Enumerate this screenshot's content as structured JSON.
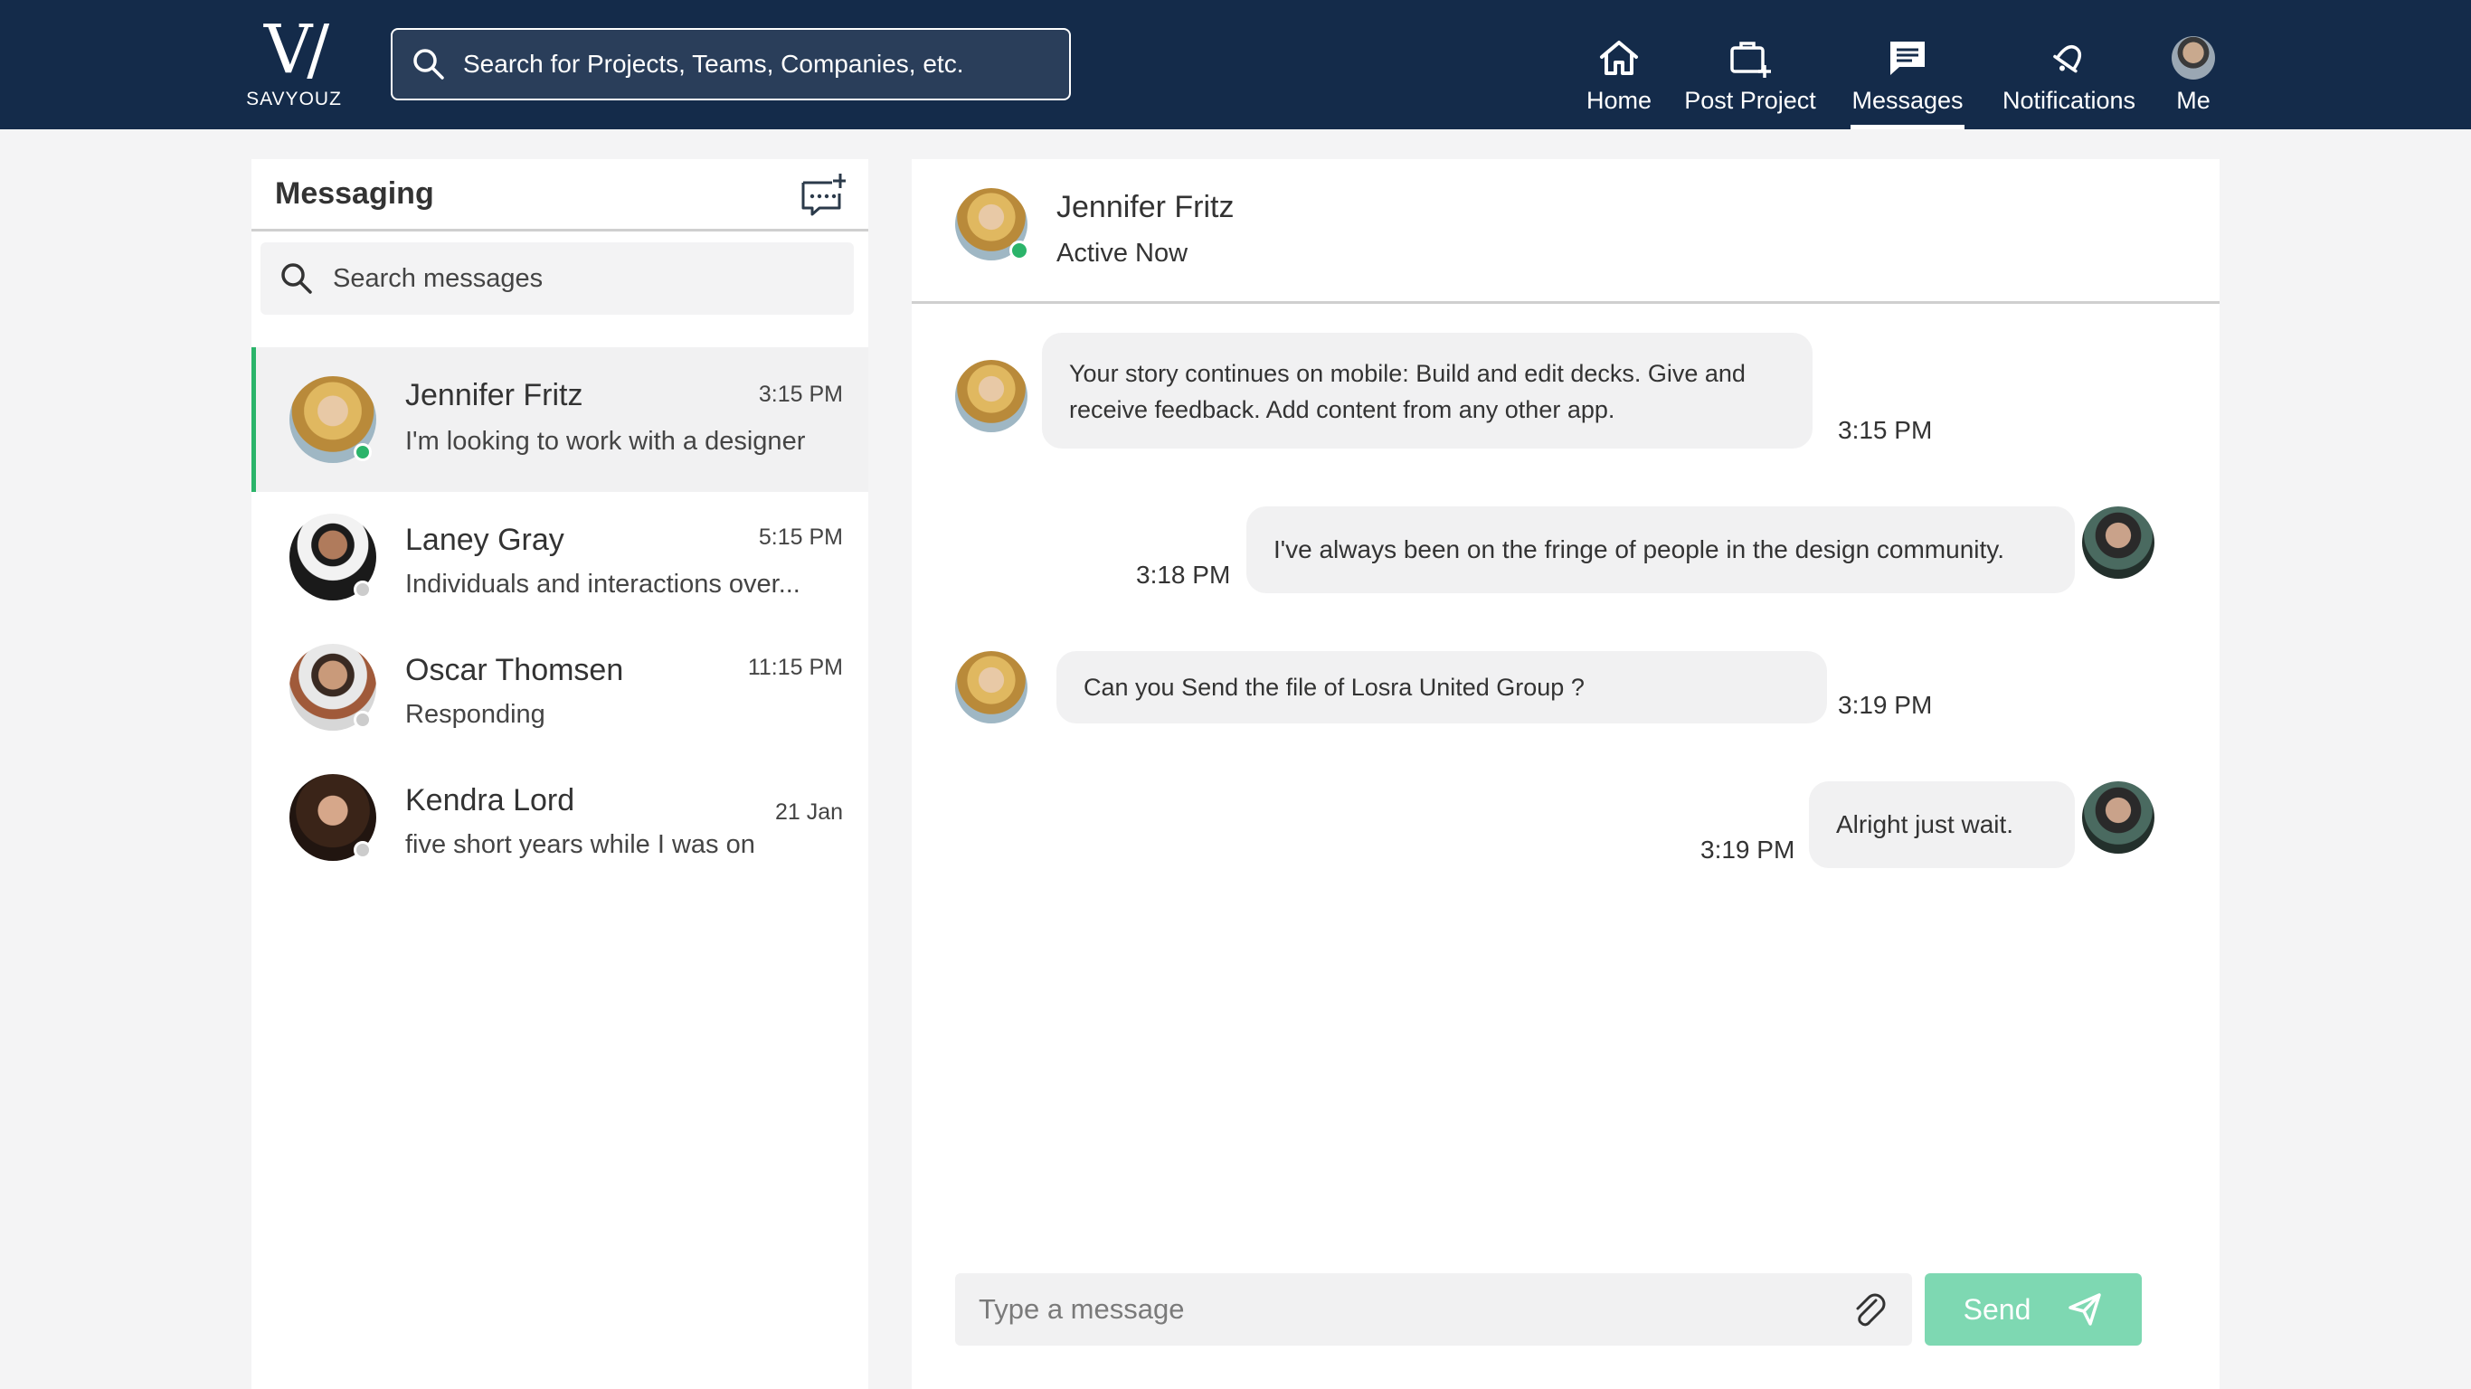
{
  "brand": {
    "logo_mark": "V/",
    "logo_text": "SAVYOUZ"
  },
  "search": {
    "placeholder": "Search for Projects, Teams, Companies, etc."
  },
  "nav": {
    "items": [
      {
        "label": "Home",
        "icon": "home-icon"
      },
      {
        "label": "Post Project",
        "icon": "briefcase-plus-icon"
      },
      {
        "label": "Messages",
        "icon": "message-icon",
        "active": true
      },
      {
        "label": "Notifications",
        "icon": "bell-icon"
      },
      {
        "label": "Me",
        "icon": "avatar"
      }
    ]
  },
  "messaging": {
    "title": "Messaging",
    "new_message_icon": "new-message-icon",
    "search_placeholder": "Search messages",
    "conversations": [
      {
        "name": "Jennifer Fritz",
        "time": "3:15 PM",
        "preview": "I'm looking to work with a designer",
        "online": true,
        "active": true
      },
      {
        "name": "Laney Gray",
        "time": "5:15 PM",
        "preview": "Individuals and interactions over...",
        "online": false
      },
      {
        "name": "Oscar Thomsen",
        "time": "11:15 PM",
        "preview": "Responding",
        "online": false
      },
      {
        "name": "Kendra Lord",
        "time": "21 Jan",
        "preview": "five short years while I was on",
        "online": false
      }
    ]
  },
  "chat": {
    "contact_name": "Jennifer Fritz",
    "contact_status": "Active Now",
    "messages": [
      {
        "from": "them",
        "text": "Your story continues on mobile: Build and edit decks. Give and receive feedback. Add content from any other app.",
        "time": "3:15 PM"
      },
      {
        "from": "me",
        "text": "I've always been on the fringe of people in the design community.",
        "time": "3:18 PM"
      },
      {
        "from": "them",
        "text": "Can you Send the file of Losra United Group ?",
        "time": "3:19 PM"
      },
      {
        "from": "me",
        "text": "Alright just wait.",
        "time": "3:19 PM"
      }
    ],
    "composer_placeholder": "Type a message",
    "send_label": "Send"
  },
  "colors": {
    "topbar": "#142b4a",
    "online": "#2bb46a",
    "offline": "#cccccc",
    "send_button": "#7ed8b2",
    "active_row_border": "#2bb46a"
  }
}
